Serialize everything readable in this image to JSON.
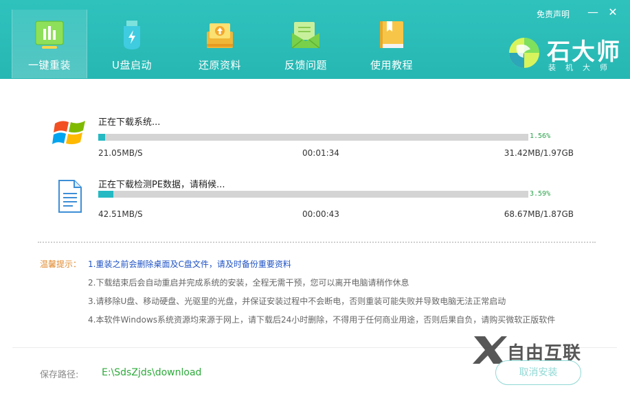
{
  "header": {
    "tabs": [
      {
        "label": "一键重装",
        "icon": "chart-icon",
        "active": true
      },
      {
        "label": "U盘启动",
        "icon": "usb-icon",
        "active": false
      },
      {
        "label": "还原资料",
        "icon": "restore-icon",
        "active": false
      },
      {
        "label": "反馈问题",
        "icon": "mail-icon",
        "active": false
      },
      {
        "label": "使用教程",
        "icon": "book-icon",
        "active": false
      }
    ],
    "disclaimer": "免责声明",
    "minimize": "—",
    "close": "✕",
    "logo_name": "石大师",
    "logo_sub": "装机大师"
  },
  "downloads": [
    {
      "title": "正在下载系统...",
      "percent_label": "1.56%",
      "percent": 1.56,
      "speed": "21.05MB/S",
      "eta": "00:01:34",
      "size": "31.42MB/1.97GB",
      "icon": "windows-logo-icon"
    },
    {
      "title": "正在下载检测PE数据，请稍候...",
      "percent_label": "3.59%",
      "percent": 3.59,
      "speed": "42.51MB/S",
      "eta": "00:00:43",
      "size": "68.67MB/1.87GB",
      "icon": "document-icon"
    }
  ],
  "tips": {
    "lead": "温馨提示：",
    "items": [
      "1.重装之前会删除桌面及C盘文件，请及时备份重要资料",
      "2.下载结束后会自动重启并完成系统的安装，全程无需干预，您可以离开电脑请稍作休息",
      "3.请移除U盘、移动硬盘、光驱里的光盘，并保证安装过程中不会断电，否则重装可能失败并导致电脑无法正常启动",
      "4.本软件Windows系统资源均来源于网上，请下载后24小时删除，不得用于任何商业用途，否则后果自负，请购买微软正版软件"
    ]
  },
  "footer": {
    "path_label": "保存路径:",
    "path_value": "E:\\SdsZjds\\download",
    "cancel_label": "取消安装"
  },
  "watermark": "自由互联",
  "colors": {
    "header": "#2fc2bd",
    "progress": "#24b9c3",
    "percent_text": "#2ba34a",
    "tip_lead": "#e18a2f",
    "tip_first": "#1f53c4",
    "path": "#2caa3a"
  }
}
